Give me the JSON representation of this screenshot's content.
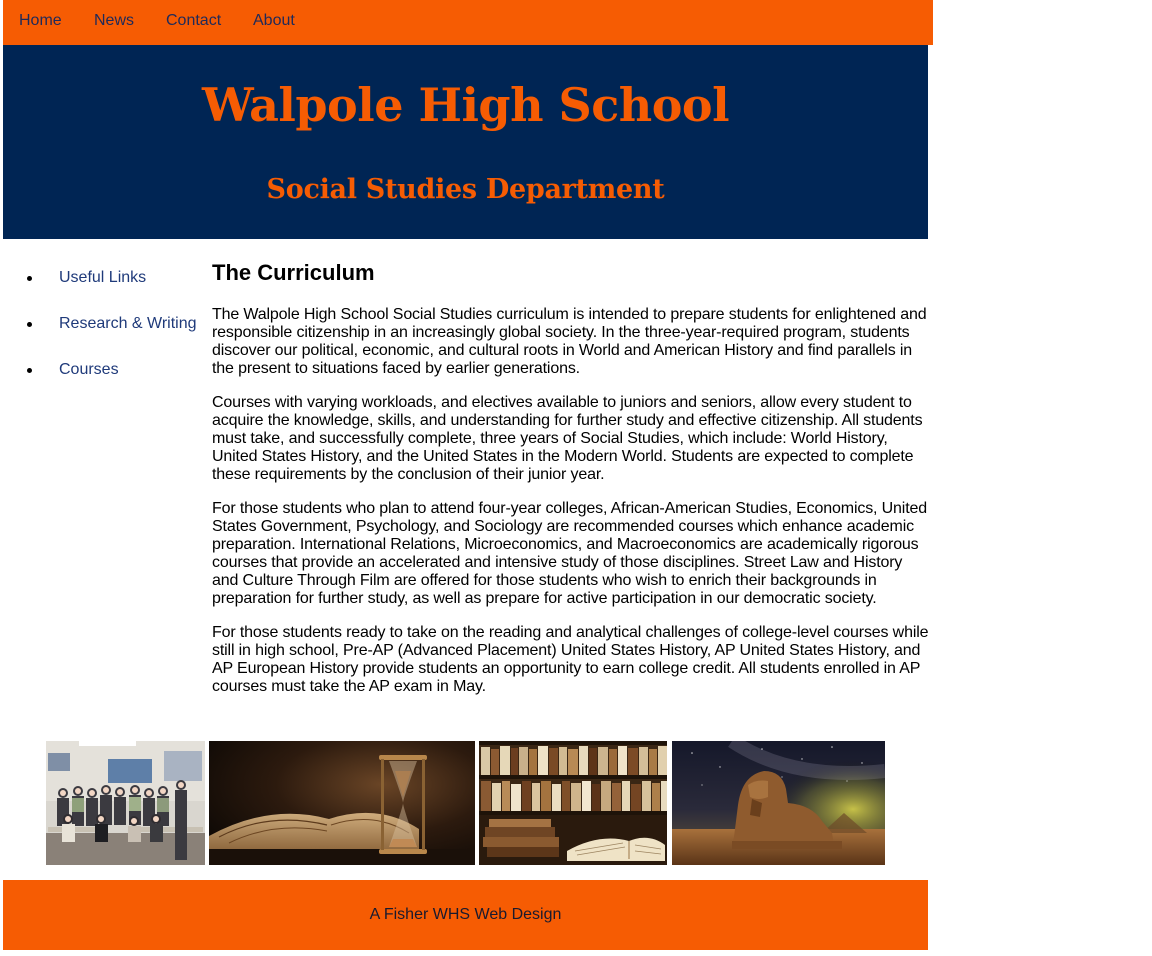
{
  "nav": {
    "items": [
      {
        "label": "Home"
      },
      {
        "label": "News"
      },
      {
        "label": "Contact"
      },
      {
        "label": "About"
      }
    ]
  },
  "banner": {
    "title": "Walpole High School",
    "subtitle": "Social Studies Department"
  },
  "sidebar": {
    "items": [
      {
        "label": "Useful Links"
      },
      {
        "label": "Research & Writing"
      },
      {
        "label": "Courses"
      }
    ]
  },
  "main": {
    "heading": "The Curriculum",
    "paragraphs": [
      "The Walpole High School Social Studies curriculum is intended to prepare students for enlightened and responsible citizenship in an increasingly global society. In the three-year-required program, students discover our political, economic, and cultural roots in World and American History and find parallels in the present to situations faced by earlier generations.",
      "Courses with varying workloads, and electives available to juniors and seniors, allow every student to acquire the knowledge, skills, and understanding for further study and effective citizenship. All students must take, and successfully complete, three years of Social Studies, which include: World History, United States History, and the United States in the Modern World. Students are expected to complete these requirements by the conclusion of their junior year.",
      "For those students who plan to attend four-year colleges, African-American Studies, Economics, United States Government, Psychology, and Sociology are recommended courses which enhance academic preparation. International Relations, Microeconomics, and Macroeconomics are academically rigorous courses that provide an accelerated and intensive study of those disciplines. Street Law and History and Culture Through Film are offered for those students who wish to enrich their backgrounds in preparation for further study, as well as prepare for active participation in our democratic society.",
      "For those students ready to take on the reading and analytical challenges of college-level courses while still in high school, Pre-AP (Advanced Placement) United States History, AP United States History, and AP European History provide students an opportunity to earn college credit. All students enrolled in AP courses must take the AP exam in May."
    ]
  },
  "gallery": {
    "photos": [
      {
        "subject": "department-group-photo"
      },
      {
        "subject": "open-book-and-hourglass"
      },
      {
        "subject": "antique-books-on-shelves"
      },
      {
        "subject": "sphinx-under-night-sky"
      }
    ]
  },
  "footer": {
    "credit": "A Fisher WHS Web Design"
  },
  "colors": {
    "accent_orange": "#f65c03",
    "navy": "#002554",
    "link_blue": "#1f3a7a"
  }
}
